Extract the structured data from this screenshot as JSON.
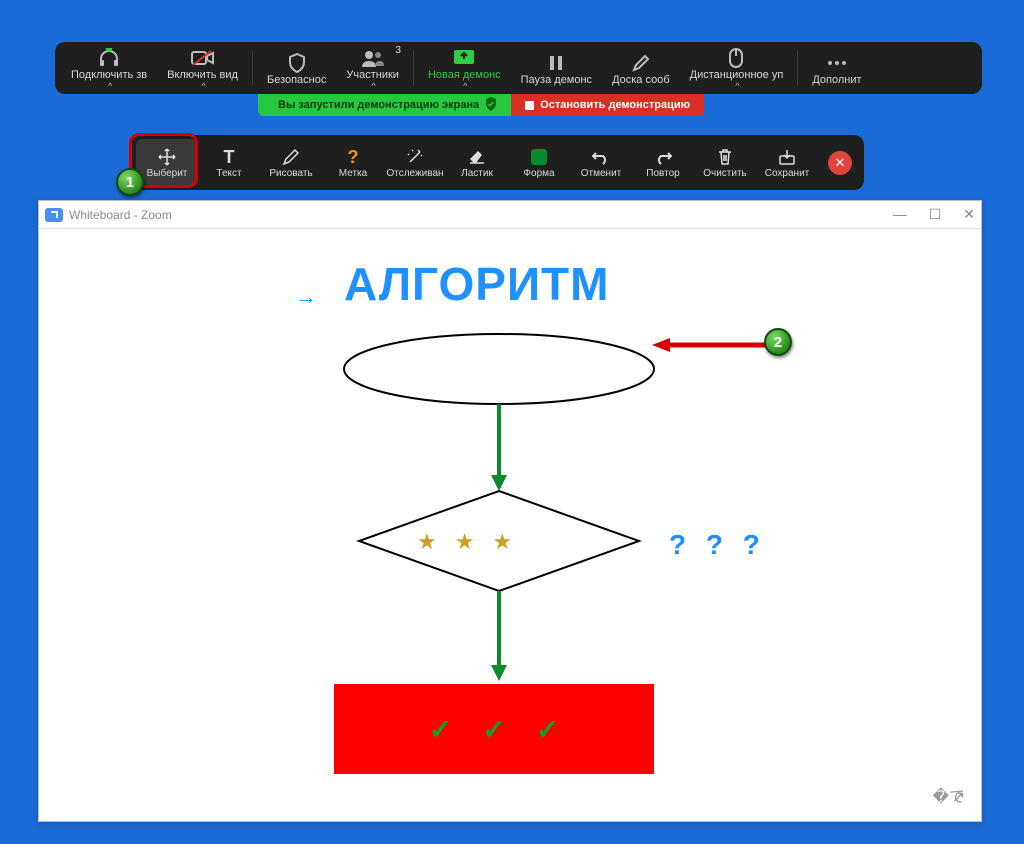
{
  "toolbar": {
    "connect_audio": "Подключить зв",
    "start_video": "Включить вид",
    "security": "Безопаснос",
    "participants": "Участники",
    "participants_count": "3",
    "new_share": "Новая демонс",
    "pause_share": "Пауза демонс",
    "whiteboard": "Доска сооб",
    "remote_control": "Дистанционное уп",
    "more": "Дополнит"
  },
  "status": {
    "sharing_text": "Вы запустили демонстрацию экрана",
    "stop_text": "Остановить демонстрацию"
  },
  "anno": {
    "select": "Выберит",
    "text": "Текст",
    "draw": "Рисовать",
    "stamp": "Метка",
    "spotlight": "Отслеживан",
    "eraser": "Ластик",
    "format": "Форма",
    "undo": "Отменит",
    "redo": "Повтор",
    "clear": "Очистить",
    "save": "Сохранит"
  },
  "callouts": {
    "one": "1",
    "two": "2"
  },
  "whiteboard": {
    "title": "Whiteboard - Zoom",
    "heading": "АЛГОРИТМ",
    "questions": "? ? ?"
  }
}
